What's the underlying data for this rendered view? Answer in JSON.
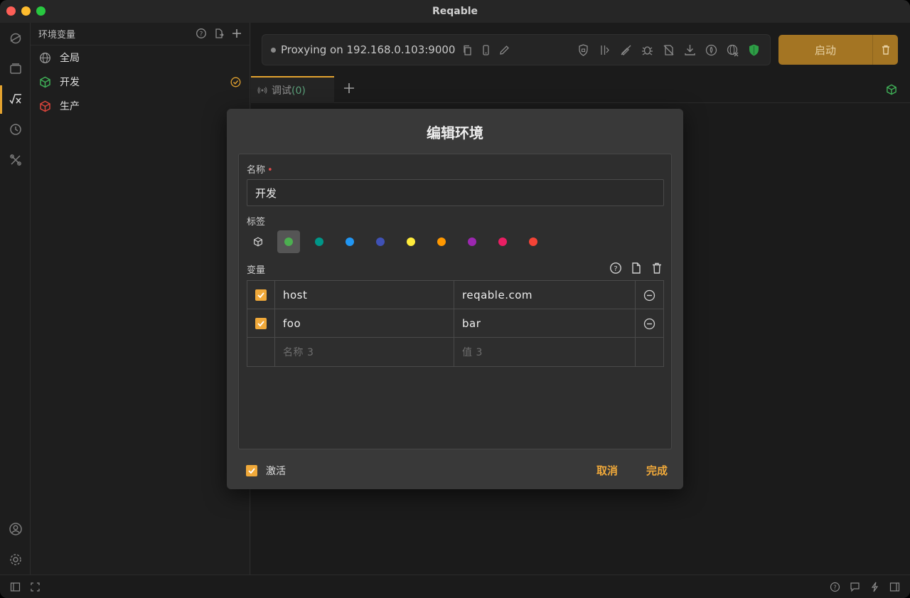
{
  "window": {
    "title": "Reqable"
  },
  "env_panel": {
    "title": "环境变量",
    "items": [
      {
        "label": "全局",
        "icon": "globe-icon",
        "color": "#9a9a9a"
      },
      {
        "label": "开发",
        "icon": "cube-icon",
        "color": "#3fae56",
        "active": true
      },
      {
        "label": "生产",
        "icon": "cube-icon",
        "color": "#d9443a"
      }
    ]
  },
  "proxy": {
    "status_text": "Proxying on 192.168.0.103:9000",
    "start_label": "启动"
  },
  "tabs": [
    {
      "label": "调试",
      "count": "(0)"
    }
  ],
  "modal": {
    "title": "编辑环境",
    "name_label": "名称",
    "name_value": "开发",
    "tag_label": "标签",
    "tag_colors": [
      "#4caf50",
      "#009688",
      "#2196f3",
      "#3f51b5",
      "#ffeb3b",
      "#ff9800",
      "#9c27b0",
      "#e91e63",
      "#f44336"
    ],
    "selected_tag": "#4caf50",
    "vars_label": "变量",
    "variables": [
      {
        "enabled": true,
        "name": "host",
        "value": "reqable.com"
      },
      {
        "enabled": true,
        "name": "foo",
        "value": "bar"
      }
    ],
    "new_row": {
      "name_placeholder": "名称 3",
      "value_placeholder": "值 3"
    },
    "activate_label": "激活",
    "cancel_label": "取消",
    "done_label": "完成"
  },
  "colors": {
    "accent": "#f0a93a",
    "start_button": "#a47523"
  }
}
